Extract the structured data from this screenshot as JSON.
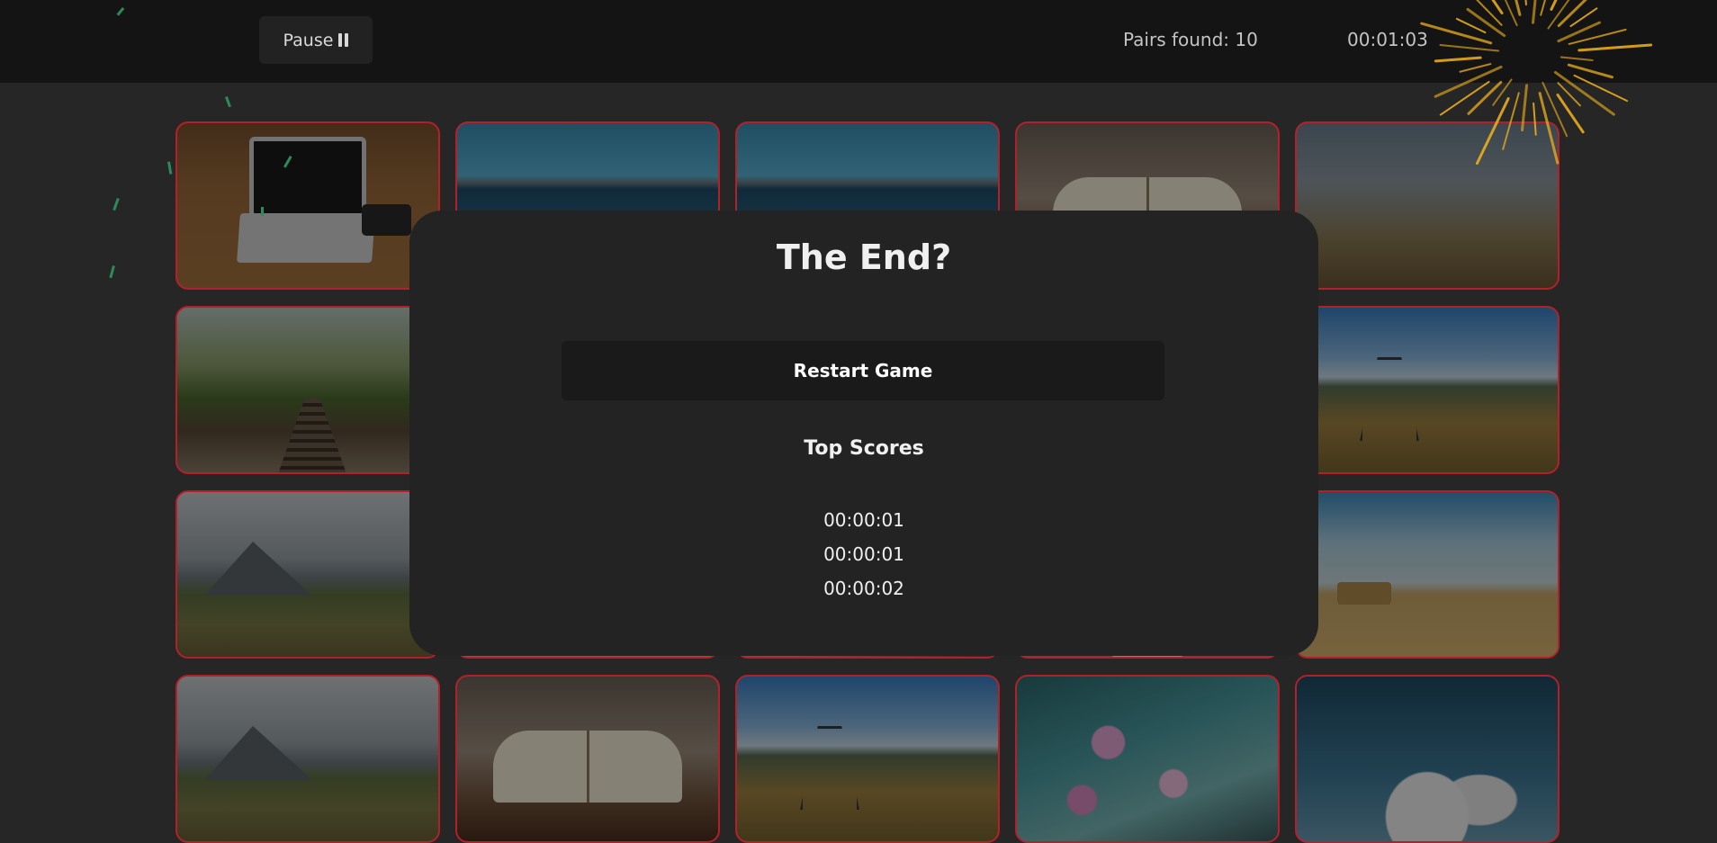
{
  "header": {
    "pause_label": "Pause",
    "pause_icon": "pause-icon",
    "pairs_found": "Pairs found: 10",
    "timer": "00:01:03"
  },
  "modal": {
    "title": "The End?",
    "restart_label": "Restart Game",
    "top_scores_title": "Top Scores",
    "scores": [
      "00:00:01",
      "00:00:01",
      "00:00:02"
    ]
  },
  "colors": {
    "card_border": "#b3202a",
    "background": "#262626",
    "topbar": "#141414",
    "firework": "#f2b21c"
  }
}
